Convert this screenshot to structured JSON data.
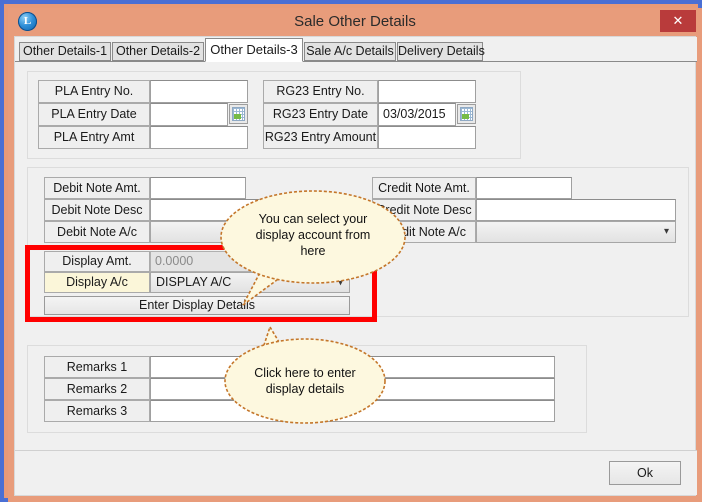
{
  "window": {
    "title": "Sale Other Details",
    "app_icon_glyph": "L",
    "app_icon_name": "app-logo-icon",
    "close_label": "✕",
    "frame_color": "#e89c7b",
    "outer_border_color": "#4a6fd4"
  },
  "tabs": [
    {
      "label": "Other Details-1",
      "active": false
    },
    {
      "label": "Other Details-2",
      "active": false
    },
    {
      "label": "Other Details-3",
      "active": true
    },
    {
      "label": "Sale A/c Details",
      "active": false
    },
    {
      "label": "Delivery Details",
      "active": false
    }
  ],
  "excise_panel": {
    "pla_entry_no_label": "PLA Entry No.",
    "pla_entry_no_value": "",
    "pla_entry_date_label": "PLA Entry Date",
    "pla_entry_date_value": "",
    "pla_entry_amt_label": "PLA Entry Amt",
    "pla_entry_amt_value": "",
    "rg23_entry_no_label": "RG23 Entry No.",
    "rg23_entry_no_value": "",
    "rg23_entry_date_label": "RG23 Entry Date",
    "rg23_entry_date_value": "03/03/2015",
    "rg23_entry_amount_label": "RG23 Entry Amount",
    "rg23_entry_amount_value": ""
  },
  "notes_panel": {
    "debit_note_amt_label": "Debit Note Amt.",
    "debit_note_amt_value": "",
    "debit_note_desc_label": "Debit Note Desc",
    "debit_note_desc_value": "",
    "debit_note_ac_label": "Debit Note A/c",
    "debit_note_ac_value": "",
    "credit_note_amt_label": "Credit Note Amt.",
    "credit_note_amt_value": "",
    "credit_note_desc_label": "Credit Note Desc",
    "credit_note_desc_value": "",
    "credit_note_ac_label": "Credit Note A/c",
    "credit_note_ac_value": ""
  },
  "display_section": {
    "highlight_color": "#ff0000",
    "display_amt_label": "Display Amt.",
    "display_amt_value": "0.0000",
    "display_ac_label": "Display A/c",
    "display_ac_value": "DISPLAY A/C",
    "enter_display_details_label": "Enter Display Details"
  },
  "remarks_panel": {
    "remarks1_label": "Remarks 1",
    "remarks1_value": "",
    "remarks2_label": "Remarks 2",
    "remarks2_value": "",
    "remarks3_label": "Remarks 3",
    "remarks3_value": ""
  },
  "callouts": [
    {
      "line1": "You can select your",
      "line2": "display account from",
      "line3": "here",
      "fill": "#fdf8df",
      "stroke": "#c4762a"
    },
    {
      "line1": "Click here to enter",
      "line2": "display details",
      "line3": "",
      "fill": "#fdf8df",
      "stroke": "#c4762a"
    }
  ],
  "footer": {
    "ok_label": "Ok"
  },
  "icons": {
    "calendar": "calendar-picker-icon",
    "chevron": "ˇ"
  }
}
